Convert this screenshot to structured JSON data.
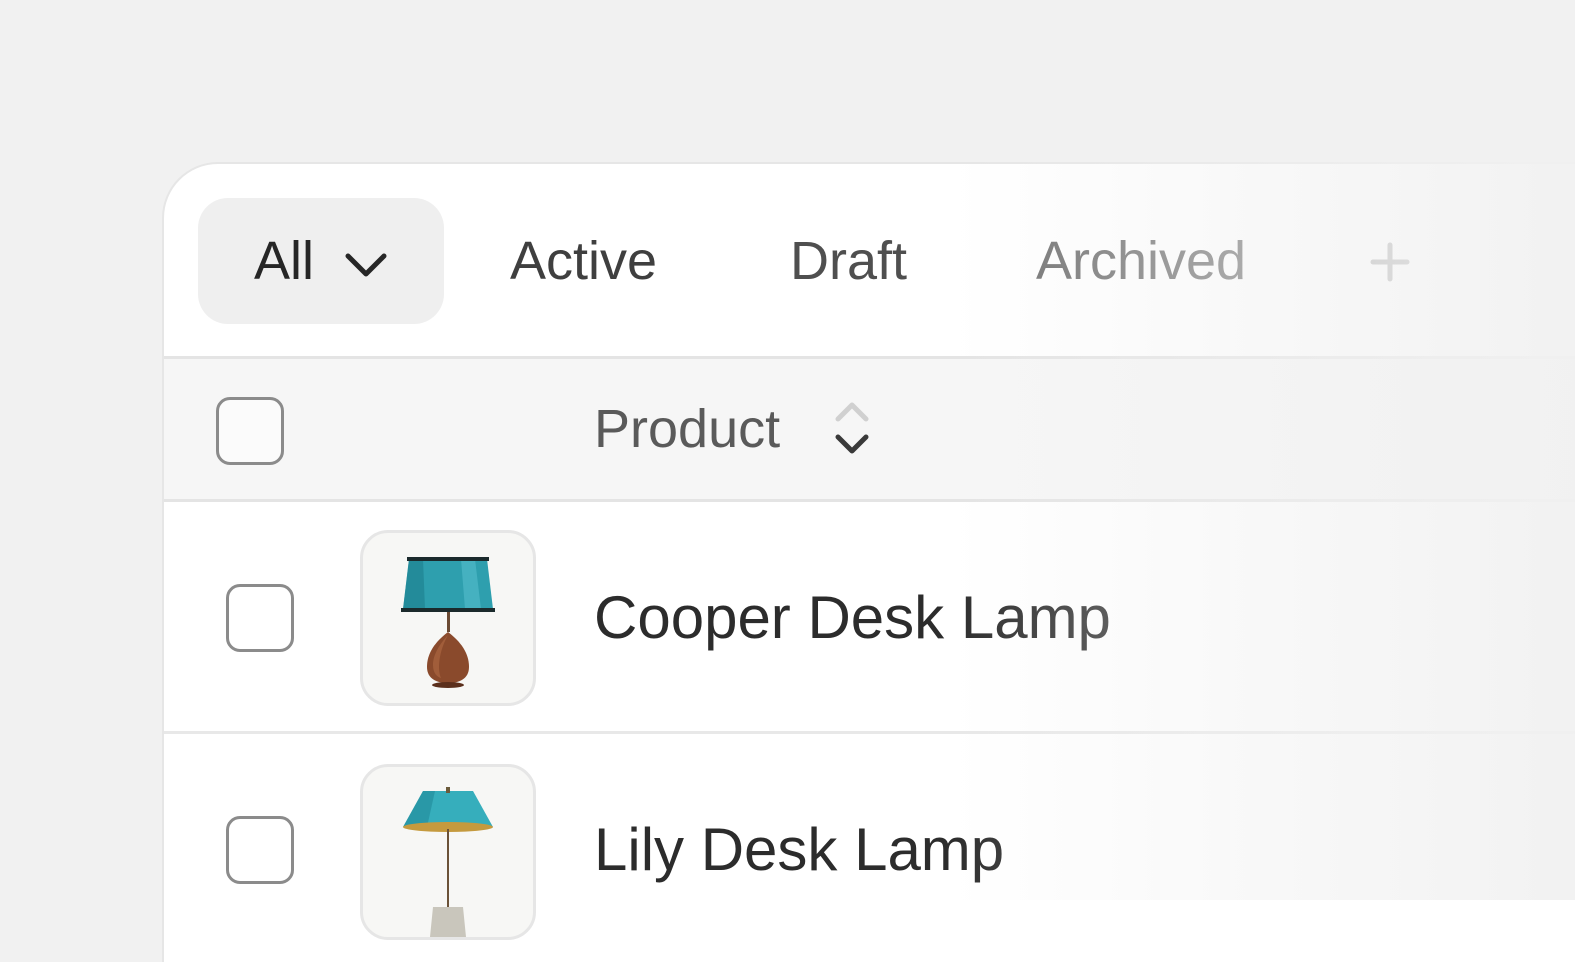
{
  "tabs": {
    "all": "All",
    "active": "Active",
    "draft": "Draft",
    "archived": "Archived",
    "add": "+"
  },
  "table": {
    "columns": [
      {
        "label": "Product",
        "sortable": true
      }
    ],
    "rows": [
      {
        "name": "Cooper Desk Lamp",
        "thumbnail": "teal-shade-wood-base-lamp"
      },
      {
        "name": "Lily Desk Lamp",
        "thumbnail": "teal-cone-shade-lamp"
      }
    ]
  },
  "icons": {
    "all_dropdown": "chevron-down-icon",
    "sort": "sort-updown-icon",
    "add": "plus-icon"
  },
  "colors": {
    "background": "#f1f1f1",
    "card": "#ffffff",
    "selected_tab": "#efefef",
    "text": "#2c2c2c",
    "muted": "#a6a6a6",
    "lamp_shade": "#2fa3b3",
    "lamp_base_wood": "#8a4a2c"
  }
}
